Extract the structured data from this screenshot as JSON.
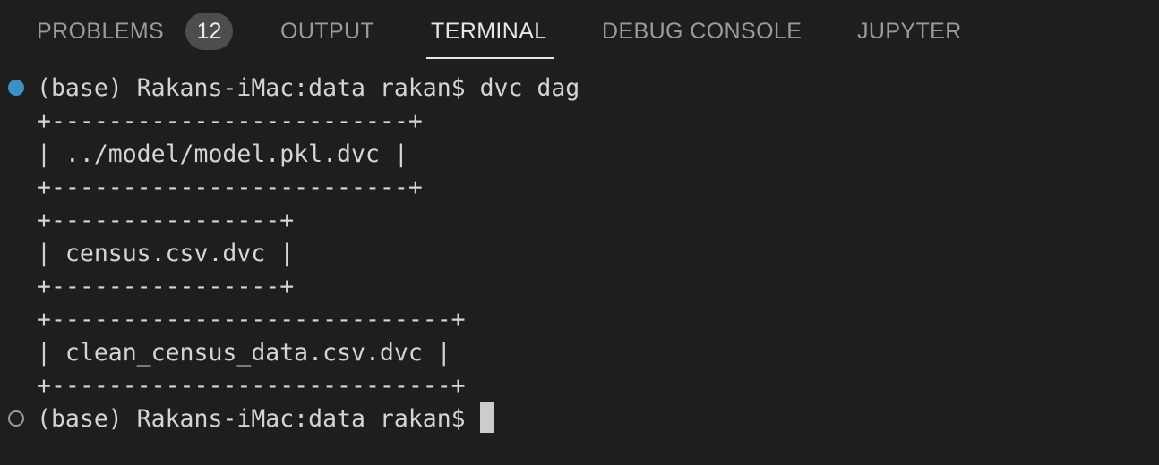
{
  "tabs": {
    "problems": "PROBLEMS",
    "problems_count": "12",
    "output": "OUTPUT",
    "terminal": "TERMINAL",
    "debug_console": "DEBUG CONSOLE",
    "jupyter": "JUPYTER"
  },
  "terminal": {
    "lines": [
      "(base) Rakans-iMac:data rakan$ dvc dag",
      "+-------------------------+",
      "| ../model/model.pkl.dvc |",
      "+-------------------------+",
      "+----------------+",
      "| census.csv.dvc |",
      "+----------------+",
      "+----------------------------+",
      "| clean_census_data.csv.dvc |",
      "+----------------------------+",
      "(base) Rakans-iMac:data rakan$"
    ]
  },
  "colors": {
    "background": "#1e1e1e",
    "text": "#d4d4d4",
    "tab_inactive": "#9a9a9a",
    "tab_active": "#e7e7e7",
    "badge": "#4d4d4d",
    "success_decoration": "#3d8fc6"
  },
  "icons": {
    "command_success": "command-success-decoration-icon",
    "command_pending": "command-pending-decoration-icon"
  }
}
